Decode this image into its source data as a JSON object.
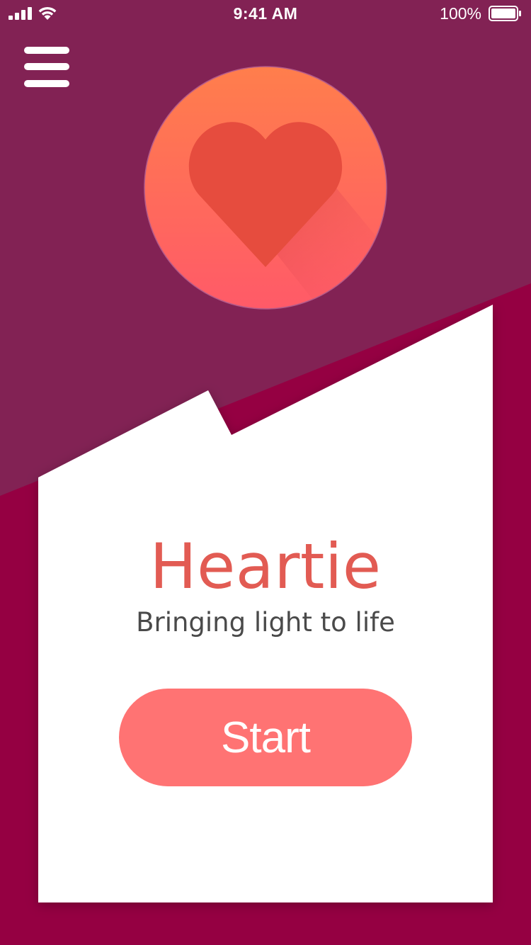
{
  "status_bar": {
    "time": "9:41 AM",
    "battery_percent": "100%",
    "battery_level": 1.0,
    "signal_bars": 4,
    "icons": [
      "signal-icon",
      "wifi-icon",
      "battery-icon"
    ]
  },
  "menu": {
    "icon": "hamburger-menu-icon"
  },
  "logo": {
    "icon": "heart-icon"
  },
  "hero": {
    "title": "Heartie",
    "tagline": "Bringing light to life"
  },
  "actions": {
    "start_label": "Start"
  },
  "colors": {
    "top_background": "#822254",
    "bottom_background": "#950042",
    "card_background": "#ffffff",
    "title": "#e25b53",
    "button": "#ff7373",
    "logo_gradient_top": "#ff7e4c",
    "logo_gradient_bottom": "#ff5a68",
    "heart": "#e64c3e"
  }
}
